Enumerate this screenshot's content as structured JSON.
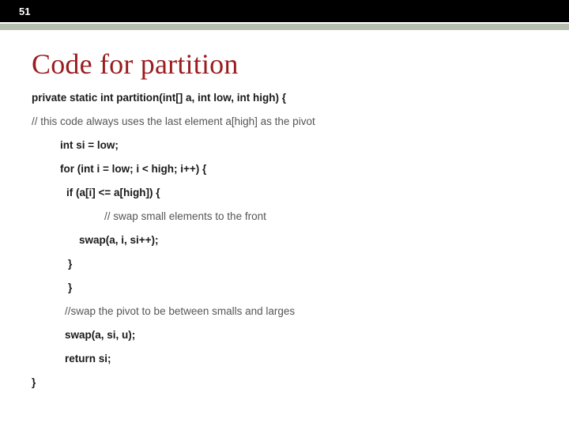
{
  "page_number": "51",
  "title": "Code for partition",
  "code": {
    "sig": "private static int partition(int[] a, int low, int high) {",
    "c1": "// this code always uses the last element a[high] as the pivot",
    "l1": "int si = low;",
    "l2": "for (int i = low; i < high; i++) {",
    "l3": "if (a[i] <= a[high]) {",
    "c2": "// swap small elements to the front",
    "l4": "swap(a, i, si++);",
    "l5": "}",
    "l6": "}",
    "c3": "//swap the pivot to be between smalls and larges",
    "l7": "swap(a, si, u);",
    "l8": "return si;",
    "l9": "}"
  }
}
